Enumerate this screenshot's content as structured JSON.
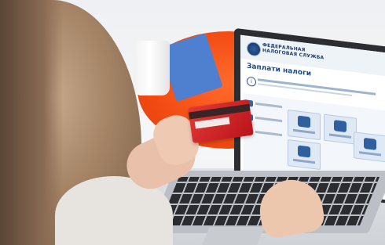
{
  "photo": {
    "subject": "person-paying-taxes-online",
    "colors": {
      "table": "#f24a12",
      "card": "#d02028",
      "site_blue": "#1e4a86",
      "laptop": "#2b2d31"
    }
  },
  "screen": {
    "org_name_line1": "ФЕДЕРАЛЬНАЯ",
    "org_name_line2": "НАЛОГОВАЯ СЛУЖБА",
    "page_title": "Заплати налоги",
    "info_icon": "info-icon"
  }
}
